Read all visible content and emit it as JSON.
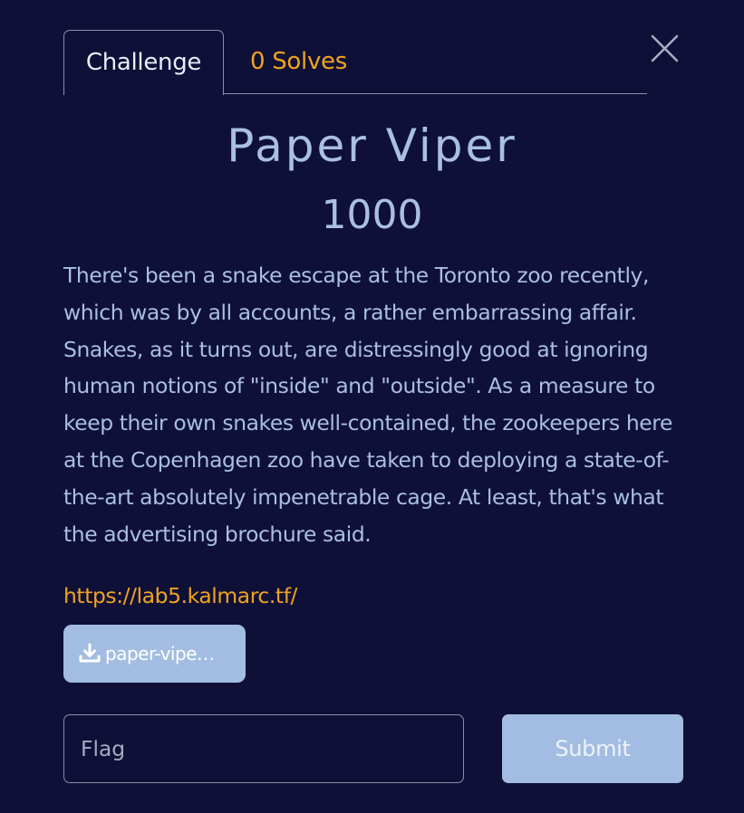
{
  "tabs": [
    {
      "label": "Challenge",
      "active": true
    },
    {
      "label": "0 Solves",
      "active": false
    }
  ],
  "close_icon": "close-icon",
  "challenge": {
    "name": "Paper Viper",
    "points": "1000",
    "description": "There's been a snake escape at the Toronto zoo recently, which was by all accounts, a rather embarrassing affair. Snakes, as it turns out, are distressingly good at ignoring human notions of \"inside\" and \"outside\". As a measure to keep their own snakes well-contained, the zookeepers here at the Copenhagen zoo have taken to deploying a state-of-the-art absolutely impenetrable cage. At least, that's what the advertising brochure said.",
    "link": "https://lab5.kalmarc.tf/",
    "file": {
      "label": "paper-vipe…",
      "icon": "download-icon"
    }
  },
  "form": {
    "flag_placeholder": "Flag",
    "flag_value": "",
    "submit_label": "Submit"
  },
  "colors": {
    "background": "#0f1038",
    "text": "#a9bfe3",
    "accent": "#f0a31f",
    "button": "#a3bde2"
  }
}
